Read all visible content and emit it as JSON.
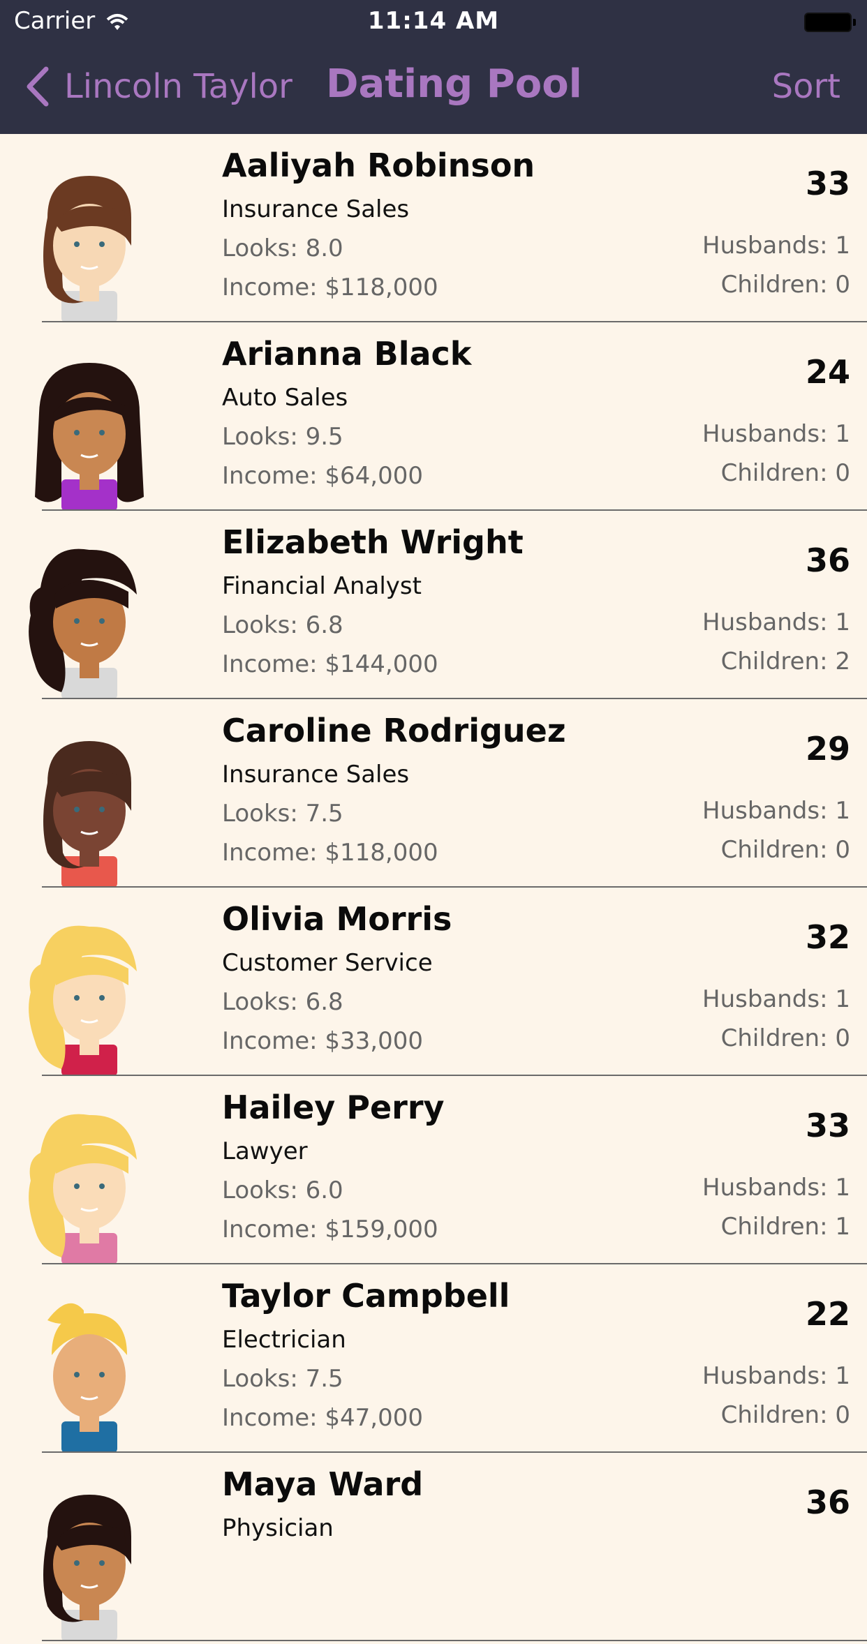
{
  "status_bar": {
    "carrier": "Carrier",
    "time": "11:14 AM"
  },
  "nav": {
    "back_label": "Lincoln Taylor",
    "title": "Dating Pool",
    "sort_label": "Sort"
  },
  "people": [
    {
      "name": "Aaliyah Robinson",
      "job": "Insurance Sales",
      "looks": "Looks: 8.0",
      "income": "Income: $118,000",
      "age": "33",
      "husbands": "Husbands: 1",
      "children": "Children: 0",
      "skin": "#f7d8b5",
      "hair": "#6b3a22",
      "shirt": "#d9d9d9",
      "style": "bob"
    },
    {
      "name": "Arianna Black",
      "job": "Auto Sales",
      "looks": "Looks: 9.5",
      "income": "Income: $64,000",
      "age": "24",
      "husbands": "Husbands: 1",
      "children": "Children: 0",
      "skin": "#c98752",
      "hair": "#24120f",
      "shirt": "#a431c9",
      "style": "long"
    },
    {
      "name": "Elizabeth Wright",
      "job": "Financial Analyst",
      "looks": "Looks: 6.8",
      "income": "Income: $144,000",
      "age": "36",
      "husbands": "Husbands: 1",
      "children": "Children: 2",
      "skin": "#c07a45",
      "hair": "#24120f",
      "shirt": "#d9d9d9",
      "style": "curly"
    },
    {
      "name": "Caroline Rodriguez",
      "job": "Insurance Sales",
      "looks": "Looks: 7.5",
      "income": "Income: $118,000",
      "age": "29",
      "husbands": "Husbands: 1",
      "children": "Children: 0",
      "skin": "#7a4433",
      "hair": "#4a2a1e",
      "shirt": "#e8584c",
      "style": "bob"
    },
    {
      "name": "Olivia Morris",
      "job": "Customer Service",
      "looks": "Looks: 6.8",
      "income": "Income: $33,000",
      "age": "32",
      "husbands": "Husbands: 1",
      "children": "Children: 0",
      "skin": "#fadcb8",
      "hair": "#f7d060",
      "shirt": "#d0214a",
      "style": "curly"
    },
    {
      "name": "Hailey Perry",
      "job": "Lawyer",
      "looks": "Looks: 6.0",
      "income": "Income: $159,000",
      "age": "33",
      "husbands": "Husbands: 1",
      "children": "Children: 1",
      "skin": "#fadcb8",
      "hair": "#f7d060",
      "shirt": "#e07aa5",
      "style": "curly"
    },
    {
      "name": "Taylor Campbell",
      "job": "Electrician",
      "looks": "Looks: 7.5",
      "income": "Income: $47,000",
      "age": "22",
      "husbands": "Husbands: 1",
      "children": "Children: 0",
      "skin": "#e8ae7a",
      "hair": "#f5c94a",
      "shirt": "#1f6fa3",
      "style": "ponytail"
    },
    {
      "name": "Maya Ward",
      "job": "Physician",
      "looks": "",
      "income": "",
      "age": "36",
      "husbands": "",
      "children": "",
      "skin": "#c98752",
      "hair": "#24120f",
      "shirt": "#d9d9d9",
      "style": "bob"
    }
  ]
}
